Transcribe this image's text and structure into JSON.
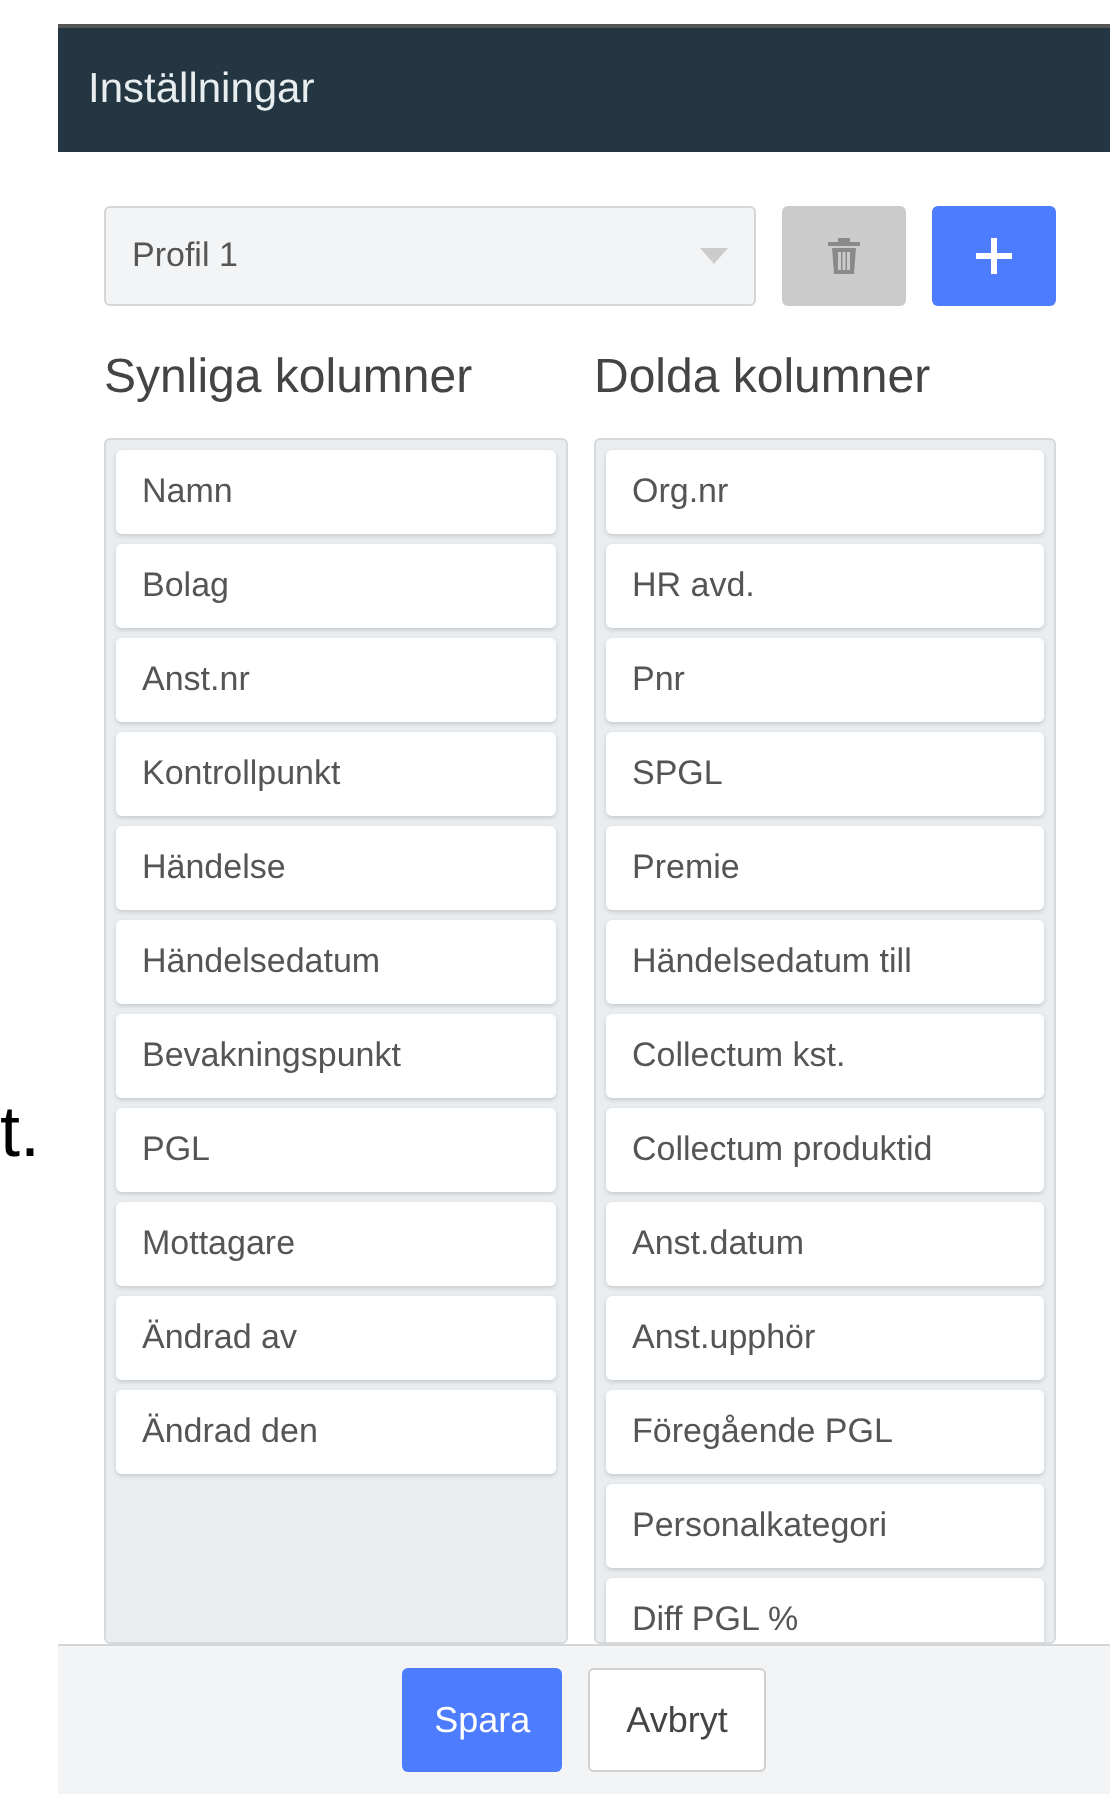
{
  "background_text": "t.",
  "dialog": {
    "title": "Inställningar",
    "profile_select": {
      "value": "Profil 1"
    },
    "visible_columns": {
      "heading": "Synliga kolumner",
      "items": [
        "Namn",
        "Bolag",
        "Anst.nr",
        "Kontrollpunkt",
        "Händelse",
        "Händelsedatum",
        "Bevakningspunkt",
        "PGL",
        "Mottagare",
        "Ändrad av",
        "Ändrad den"
      ]
    },
    "hidden_columns": {
      "heading": "Dolda kolumner",
      "items": [
        "Org.nr",
        "HR avd.",
        "Pnr",
        "SPGL",
        "Premie",
        "Händelsedatum till",
        "Collectum kst.",
        "Collectum produktid",
        "Anst.datum",
        "Anst.upphör",
        "Föregående PGL",
        "Personalkategori",
        "Diff PGL %"
      ]
    },
    "buttons": {
      "save": "Spara",
      "cancel": "Avbryt"
    }
  }
}
